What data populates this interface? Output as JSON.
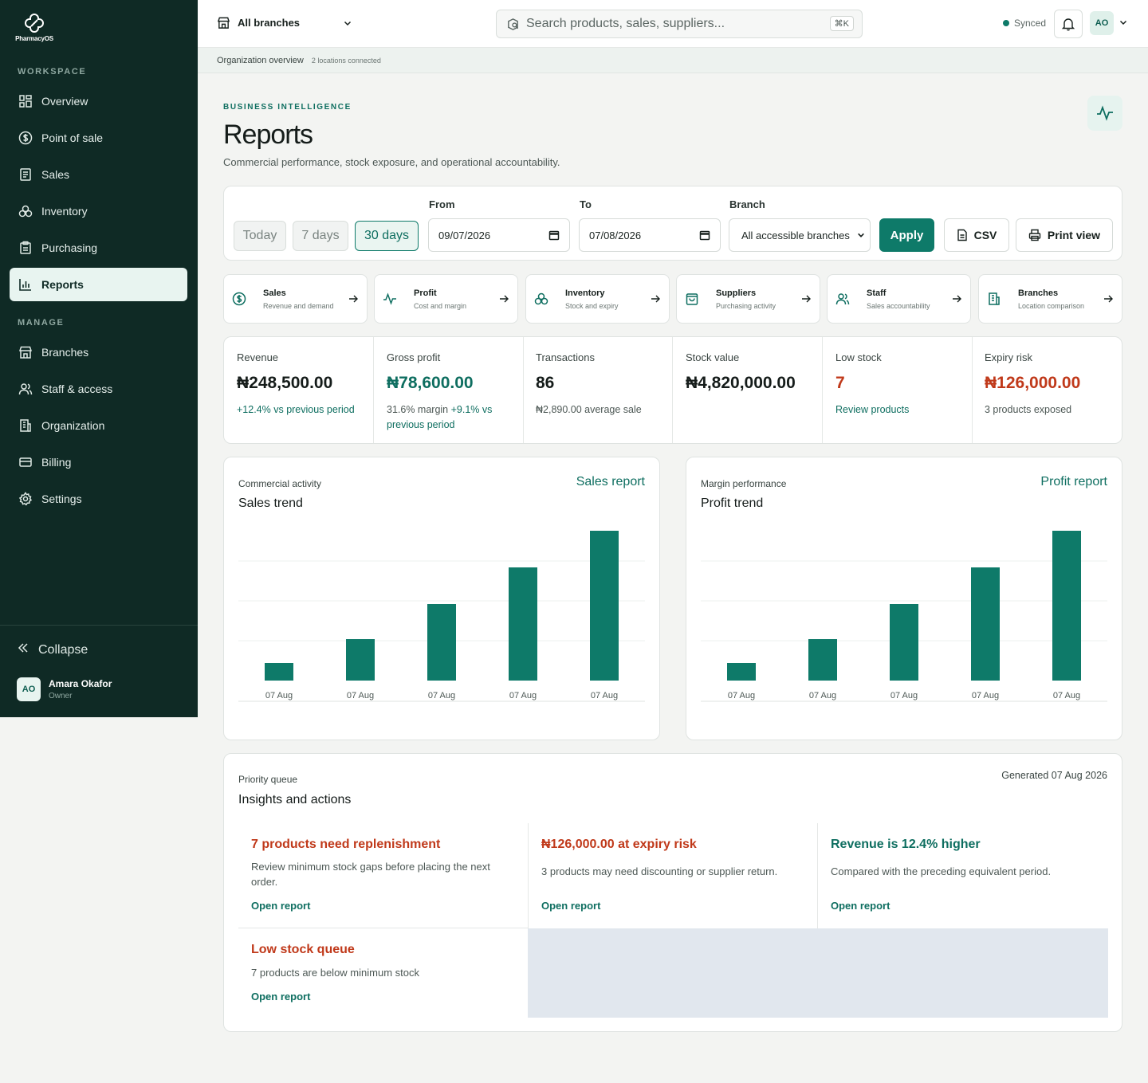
{
  "sidebar": {
    "logo": "PharmacyOS",
    "workspace_label": "WORKSPACE",
    "manage_label": "MANAGE",
    "workspace_items": [
      {
        "label": "Overview",
        "icon": "grid-icon"
      },
      {
        "label": "Point of sale",
        "icon": "dollar-circle-icon"
      },
      {
        "label": "Sales",
        "icon": "receipt-icon"
      },
      {
        "label": "Inventory",
        "icon": "boxes-icon"
      },
      {
        "label": "Purchasing",
        "icon": "clipboard-icon"
      },
      {
        "label": "Reports",
        "icon": "bar-chart-icon",
        "active": true
      }
    ],
    "manage_items": [
      {
        "label": "Branches",
        "icon": "store-icon"
      },
      {
        "label": "Staff & access",
        "icon": "users-icon"
      },
      {
        "label": "Organization",
        "icon": "building-icon"
      },
      {
        "label": "Billing",
        "icon": "card-icon"
      },
      {
        "label": "Settings",
        "icon": "gear-icon"
      }
    ],
    "collapse_label": "Collapse",
    "user": {
      "initials": "AO",
      "name": "Amara Okafor",
      "role": "Owner"
    }
  },
  "topbar": {
    "branch": "All branches",
    "search_placeholder": "Search products, sales, suppliers...",
    "shortcut": "⌘K",
    "sync_status": "Synced",
    "avatar_initials": "AO"
  },
  "subbar": {
    "title": "Organization overview",
    "meta": "2 locations connected"
  },
  "header": {
    "eyebrow": "BUSINESS INTELLIGENCE",
    "title": "Reports",
    "subtitle": "Commercial performance, stock exposure, and operational accountability."
  },
  "filters": {
    "ranges": [
      "Today",
      "7 days",
      "30 days"
    ],
    "active_range": "30 days",
    "from_label": "From",
    "from_value": "09/07/2026",
    "to_label": "To",
    "to_value": "07/08/2026",
    "branch_label": "Branch",
    "branch_value": "All accessible branches",
    "apply_label": "Apply",
    "csv_label": "CSV",
    "print_label": "Print view"
  },
  "report_tiles": [
    {
      "title": "Sales",
      "subtitle": "Revenue and demand",
      "icon": "dollar-circle-icon"
    },
    {
      "title": "Profit",
      "subtitle": "Cost and margin",
      "icon": "pulse-icon"
    },
    {
      "title": "Inventory",
      "subtitle": "Stock and expiry",
      "icon": "boxes-icon"
    },
    {
      "title": "Suppliers",
      "subtitle": "Purchasing activity",
      "icon": "bag-icon"
    },
    {
      "title": "Staff",
      "subtitle": "Sales accountability",
      "icon": "users-icon"
    },
    {
      "title": "Branches",
      "subtitle": "Location comparison",
      "icon": "building-icon"
    }
  ],
  "kpis": [
    {
      "label": "Revenue",
      "value": "₦248,500.00",
      "note": "+12.4% vs previous period"
    },
    {
      "label": "Gross profit",
      "value": "₦78,600.00",
      "note_a": "31.6% margin ",
      "note_b": "+9.1% vs previous period"
    },
    {
      "label": "Transactions",
      "value": "86",
      "note": "₦2,890.00 average sale"
    },
    {
      "label": "Stock value",
      "value": "₦4,820,000.00",
      "note": ""
    },
    {
      "label": "Low stock",
      "value": "7",
      "note": "Review products"
    },
    {
      "label": "Expiry risk",
      "value": "₦126,000.00",
      "note": "3 products exposed"
    }
  ],
  "charts": {
    "sales": {
      "eyebrow": "Commercial activity",
      "title": "Sales trend",
      "link": "Sales report"
    },
    "profit": {
      "eyebrow": "Margin performance",
      "title": "Profit trend",
      "link": "Profit report"
    }
  },
  "chart_data": [
    {
      "type": "bar",
      "categories": [
        "07 Aug",
        "07 Aug",
        "07 Aug",
        "07 Aug",
        "07 Aug"
      ],
      "values": [
        11,
        26,
        48,
        71,
        94
      ],
      "ylim": [
        0,
        100
      ],
      "grid": true,
      "bar_color": "#0e7a69"
    },
    {
      "type": "bar",
      "categories": [
        "07 Aug",
        "07 Aug",
        "07 Aug",
        "07 Aug",
        "07 Aug"
      ],
      "values": [
        11,
        26,
        48,
        71,
        94
      ],
      "ylim": [
        0,
        100
      ],
      "grid": true,
      "bar_color": "#0e7a69"
    }
  ],
  "insights": {
    "eyebrow": "Priority queue",
    "title": "Insights and actions",
    "generated": "Generated 07 Aug 2026",
    "link_label": "Open report",
    "items": [
      {
        "title": "7 products need replenishment",
        "desc": "Review minimum stock gaps before placing the next order."
      },
      {
        "title": "₦126,000.00 at expiry risk",
        "desc": "3 products may need discounting or supplier return."
      },
      {
        "title": "Revenue is 12.4% higher",
        "desc": "Compared with the preceding equivalent period."
      },
      {
        "title": "Low stock queue",
        "desc": "7 products are below minimum stock"
      }
    ]
  },
  "colors": {
    "brand": "#0e7a69",
    "sidebar": "#0f2a25",
    "alert": "#c0391a"
  }
}
